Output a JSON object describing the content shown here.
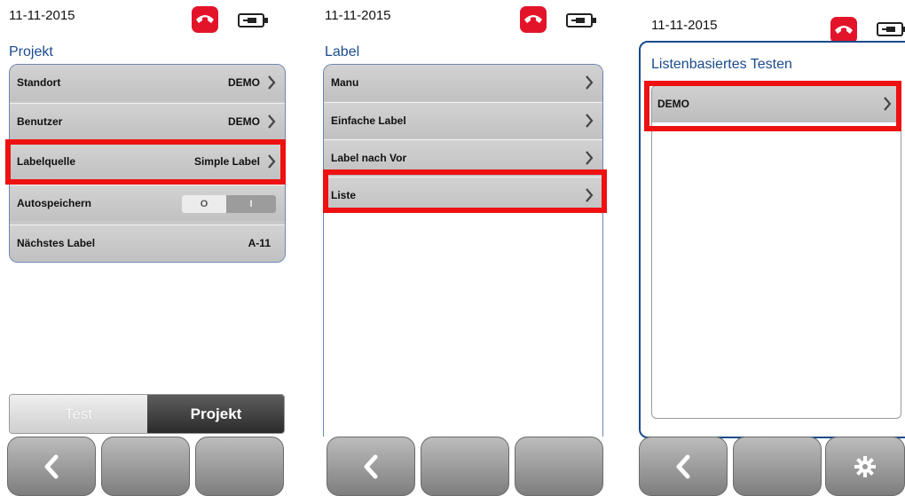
{
  "screens": [
    {
      "date": "11-11-2015",
      "heading": "Projekt",
      "rows": [
        {
          "label": "Standort",
          "value": "DEMO"
        },
        {
          "label": "Benutzer",
          "value": "DEMO"
        },
        {
          "label": "Labelquelle",
          "value": "Simple Label"
        },
        {
          "label": "Autospeichern",
          "toggle_on": "O",
          "toggle_off": "I",
          "toggle_state": "off"
        },
        {
          "label": "Nächstes Label",
          "value": "A-11"
        }
      ],
      "tabs": {
        "test": "Test",
        "project": "Projekt"
      }
    },
    {
      "date": "11-11-2015",
      "heading": "Label",
      "rows": [
        {
          "label": "Manu"
        },
        {
          "label": "Einfache Label"
        },
        {
          "label": "Label nach Vor"
        },
        {
          "label": "Liste"
        }
      ]
    },
    {
      "date": "11-11-2015",
      "title": "Listenbasiertes Testen",
      "rows": [
        {
          "label": "DEMO"
        }
      ]
    }
  ],
  "icons": {
    "status": [
      "phone-hangup-icon",
      "battery-plug-icon"
    ],
    "softkeys": [
      "back-arrow-icon",
      "gear-icon"
    ]
  },
  "colors": {
    "accent": "#1a4b8c",
    "highlight": "#ee1111",
    "phone": "#e3142a"
  }
}
